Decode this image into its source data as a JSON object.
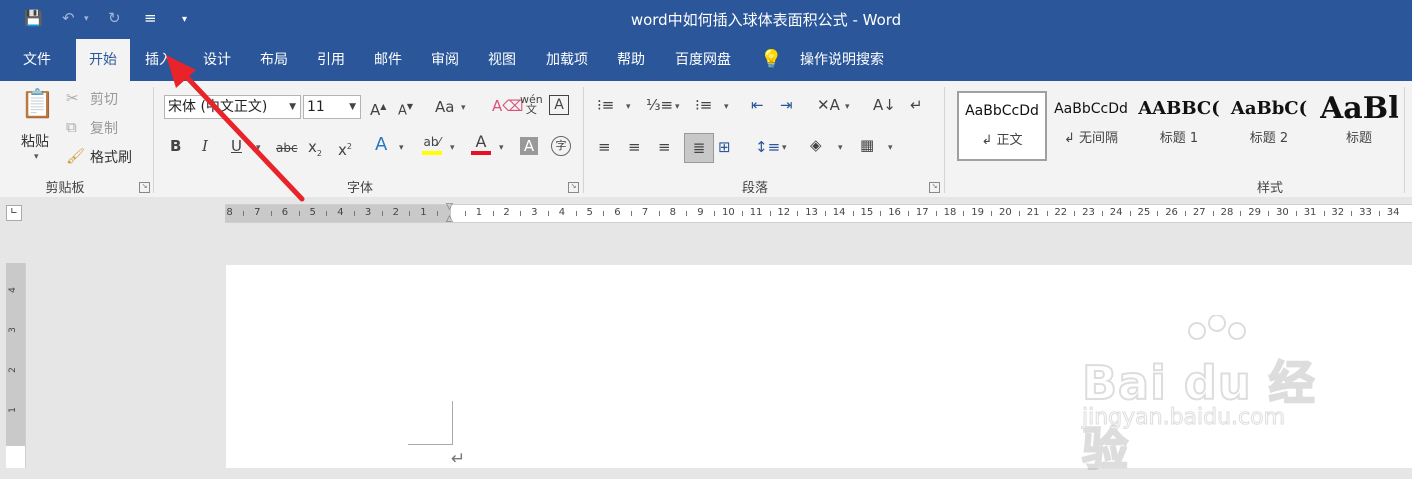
{
  "app": {
    "title": "word中如何插入球体表面积公式  -  Word"
  },
  "tabs": [
    {
      "label": "文件",
      "active": false
    },
    {
      "label": "开始",
      "active": true
    },
    {
      "label": "插入",
      "active": false
    },
    {
      "label": "设计",
      "active": false
    },
    {
      "label": "布局",
      "active": false
    },
    {
      "label": "引用",
      "active": false
    },
    {
      "label": "邮件",
      "active": false
    },
    {
      "label": "审阅",
      "active": false
    },
    {
      "label": "视图",
      "active": false
    },
    {
      "label": "加载项",
      "active": false
    },
    {
      "label": "帮助",
      "active": false
    },
    {
      "label": "百度网盘",
      "active": false
    }
  ],
  "tell_me": {
    "label": "操作说明搜索"
  },
  "clipboard": {
    "paste": "粘贴",
    "cut": "剪切",
    "copy": "复制",
    "format_painter": "格式刷",
    "group": "剪贴板"
  },
  "font": {
    "name": "宋体 (中文正文)",
    "size": "11",
    "group": "字体"
  },
  "paragraph": {
    "group": "段落"
  },
  "styles": {
    "group": "样式",
    "items": [
      {
        "preview": "AaBbCcDd",
        "name": "↲ 正文",
        "selected": true
      },
      {
        "preview": "AaBbCcDd",
        "name": "↲ 无间隔",
        "selected": false
      },
      {
        "preview": "AABBC(",
        "name": "标题 1",
        "selected": false
      },
      {
        "preview": "AaBbC(",
        "name": "标题 2",
        "selected": false
      },
      {
        "preview": "AaBl",
        "name": "标题",
        "selected": false
      }
    ]
  },
  "ruler": {
    "left_numbers": [
      "8",
      "7",
      "6",
      "5",
      "4",
      "3",
      "2",
      "1"
    ],
    "right_numbers": [
      "1",
      "2",
      "3",
      "4",
      "5",
      "6",
      "7",
      "8",
      "9",
      "10",
      "11",
      "12",
      "13",
      "14",
      "15",
      "16",
      "17",
      "18",
      "19",
      "20",
      "21",
      "22",
      "23",
      "24",
      "25",
      "26",
      "27",
      "28",
      "29",
      "30",
      "31",
      "32",
      "33",
      "34"
    ],
    "vertical_numbers": [
      "4",
      "3",
      "2",
      "1"
    ]
  },
  "watermark": {
    "main": "Bai du 经验",
    "sub": "jingyan.baidu.com"
  },
  "colors": {
    "brand": "#2b579a",
    "highlight": "#ffff00",
    "font_color": "#e81123",
    "arrow": "#e8232a"
  }
}
